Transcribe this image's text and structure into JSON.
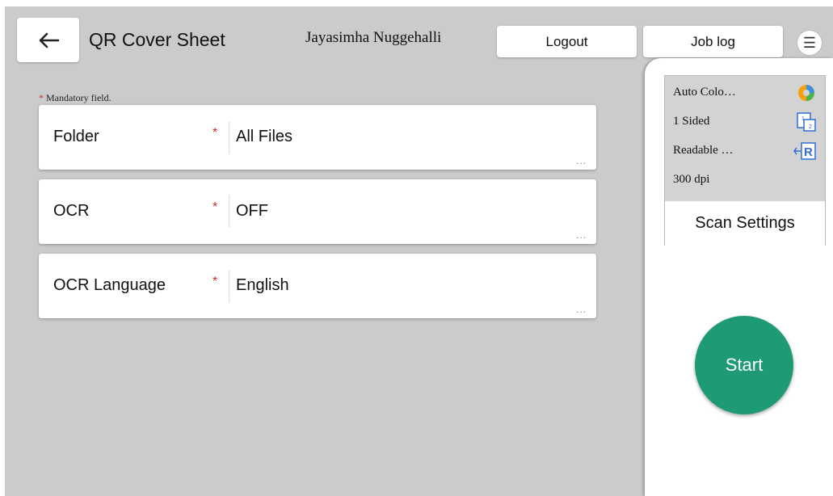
{
  "header": {
    "title": "QR Cover Sheet",
    "user": "Jayasimha Nuggehalli",
    "logout_label": "Logout",
    "joblog_label": "Job log",
    "menu_symbol": "☰"
  },
  "form": {
    "mandatory_star": "*",
    "mandatory_note": " Mandatory field.",
    "fields": [
      {
        "label": "Folder",
        "required_mark": "*",
        "value": "All Files",
        "more": "..."
      },
      {
        "label": "OCR",
        "required_mark": "*",
        "value": "OFF",
        "more": "..."
      },
      {
        "label": "OCR Language",
        "required_mark": "*",
        "value": "English",
        "more": "..."
      }
    ]
  },
  "settings": {
    "color_mode": "Auto Colo…",
    "sides": "1 Sided",
    "orientation": "Readable …",
    "resolution": "300 dpi",
    "scan_settings_label": "Scan Settings",
    "sides_icon_top": "1",
    "sides_icon_bottom": "2",
    "orientation_icon_letter": "R",
    "icons": [
      "auto-color-icon",
      "one-sided-icon",
      "readable-direction-icon"
    ]
  },
  "start_label": "Start",
  "colors": {
    "background": "#cbcbcb",
    "start": "#1e9a74",
    "required": "#c0312b",
    "icon_blue": "#2f6fd6"
  }
}
